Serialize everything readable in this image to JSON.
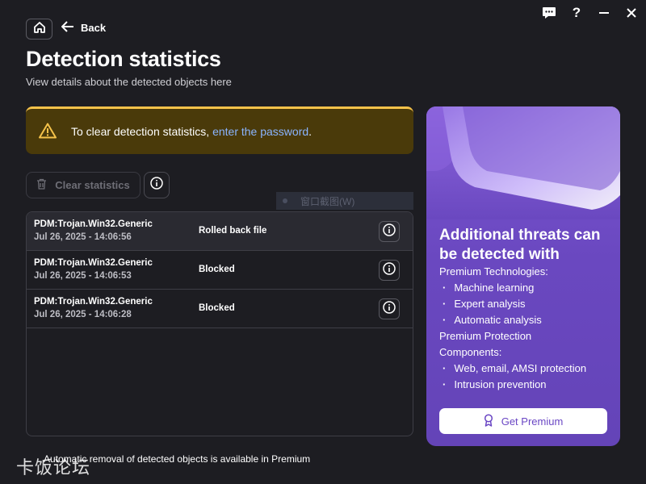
{
  "window": {
    "controls": [
      "chat-icon",
      "help-icon",
      "minimize-icon",
      "close-icon"
    ],
    "help_label": "?"
  },
  "nav": {
    "back_label": "Back"
  },
  "header": {
    "title": "Detection statistics",
    "subtitle": "View details about the detected objects here"
  },
  "warning": {
    "text": "To clear detection statistics, ",
    "link": "enter the password",
    "suffix": ".",
    "accent_color": "#f5c24a"
  },
  "toolbar": {
    "clear_label": "Clear statistics",
    "clear_enabled": false
  },
  "overlay": {
    "ghost_text": "窗口截图(W)"
  },
  "detections": [
    {
      "name": "PDM:Trojan.Win32.Generic",
      "date": "Jul 26, 2025 - 14:06:56",
      "action": "Rolled back file"
    },
    {
      "name": "PDM:Trojan.Win32.Generic",
      "date": "Jul 26, 2025 - 14:06:53",
      "action": "Blocked"
    },
    {
      "name": "PDM:Trojan.Win32.Generic",
      "date": "Jul 26, 2025 - 14:06:28",
      "action": "Blocked"
    }
  ],
  "footer": {
    "note": "Automatic removal of detected objects is available in Premium",
    "watermark": "卡饭论坛"
  },
  "promo": {
    "title": "Additional threats can be detected with",
    "intro": "Premium Technologies:",
    "technologies": [
      "Machine learning",
      "Expert analysis",
      "Automatic analysis"
    ],
    "section": "Premium Protection",
    "section2": "Components:",
    "components": [
      "Web, email, AMSI protection",
      "Intrusion prevention"
    ],
    "button_label": "Get Premium",
    "bg_color": "#6a48c0"
  }
}
